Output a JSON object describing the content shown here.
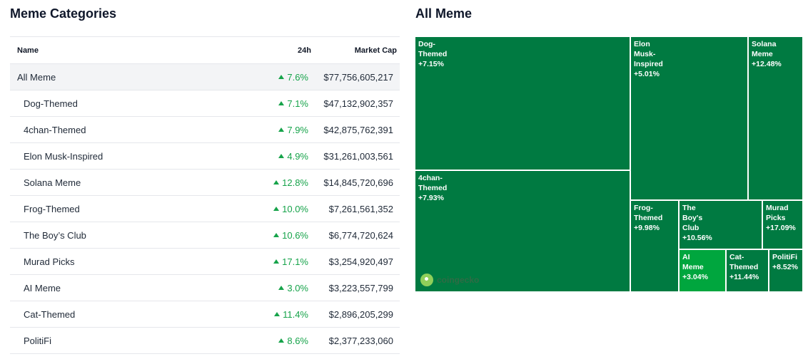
{
  "left_panel": {
    "title": "Meme Categories",
    "columns": {
      "name": "Name",
      "change": "24h",
      "mcap": "Market Cap"
    },
    "rows": [
      {
        "name": "All Meme",
        "change": "7.6%",
        "mcap": "$77,756,605,217"
      },
      {
        "name": "Dog-Themed",
        "change": "7.1%",
        "mcap": "$47,132,902,357"
      },
      {
        "name": "4chan-Themed",
        "change": "7.9%",
        "mcap": "$42,875,762,391"
      },
      {
        "name": "Elon Musk-Inspired",
        "change": "4.9%",
        "mcap": "$31,261,003,561"
      },
      {
        "name": "Solana Meme",
        "change": "12.8%",
        "mcap": "$14,845,720,696"
      },
      {
        "name": "Frog-Themed",
        "change": "10.0%",
        "mcap": "$7,261,561,352"
      },
      {
        "name": "The Boy’s Club",
        "change": "10.6%",
        "mcap": "$6,774,720,624"
      },
      {
        "name": "Murad Picks",
        "change": "17.1%",
        "mcap": "$3,254,920,497"
      },
      {
        "name": "AI Meme",
        "change": "3.0%",
        "mcap": "$3,223,557,799"
      },
      {
        "name": "Cat-Themed",
        "change": "11.4%",
        "mcap": "$2,896,205,299"
      },
      {
        "name": "PolitiFi",
        "change": "8.6%",
        "mcap": "$2,377,233,060"
      }
    ]
  },
  "right_panel": {
    "title": "All Meme",
    "tiles": [
      {
        "name": "Dog-\nThemed",
        "change": "+7.15%"
      },
      {
        "name": "Elon\nMusk-\nInspired",
        "change": "+5.01%"
      },
      {
        "name": "Solana\nMeme",
        "change": "+12.48%"
      },
      {
        "name": "4chan-\nThemed",
        "change": "+7.93%"
      },
      {
        "name": "Frog-\nThemed",
        "change": "+9.98%"
      },
      {
        "name": "The\nBoy's\nClub",
        "change": "+10.56%"
      },
      {
        "name": "Murad\nPicks",
        "change": "+17.09%"
      },
      {
        "name": "AI\nMeme",
        "change": "+3.04%"
      },
      {
        "name": "Cat-\nThemed",
        "change": "+11.44%"
      },
      {
        "name": "PolitiFi",
        "change": "+8.52%"
      }
    ],
    "watermark": "coingecko"
  },
  "colors": {
    "tile_dark": "#007a41",
    "tile_bright": "#00a63e",
    "positive": "#16a34a"
  }
}
